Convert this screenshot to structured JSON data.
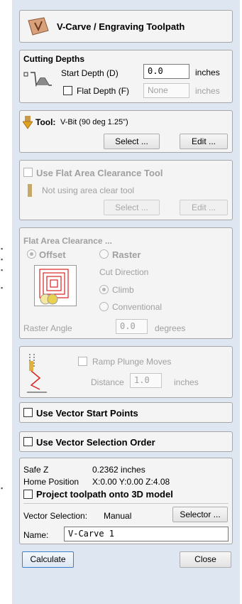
{
  "title": "V-Carve / Engraving Toolpath",
  "cutting_depths": {
    "heading": "Cutting Depths",
    "start_depth_label": "Start Depth (D)",
    "start_depth_value": "0.0",
    "start_depth_unit": "inches",
    "flat_depth_label": "Flat Depth (F)",
    "flat_depth_placeholder": "None",
    "flat_depth_unit": "inches"
  },
  "tool": {
    "label": "Tool:",
    "name": "V-Bit (90 deg 1.25\")",
    "select_label": "Select ...",
    "edit_label": "Edit ..."
  },
  "area_clear": {
    "checkbox_label": "Use Flat Area Clearance Tool",
    "status": "Not using area clear tool",
    "select_label": "Select ...",
    "edit_label": "Edit ..."
  },
  "flat_area": {
    "heading": "Flat Area Clearance ...",
    "offset_label": "Offset",
    "raster_label": "Raster",
    "cut_direction_label": "Cut Direction",
    "climb_label": "Climb",
    "conventional_label": "Conventional",
    "raster_angle_label": "Raster Angle",
    "raster_angle_value": "0.0",
    "raster_angle_unit": "degrees"
  },
  "ramp": {
    "checkbox_label": "Ramp Plunge Moves",
    "distance_label": "Distance",
    "distance_value": "1.0",
    "distance_unit": "inches"
  },
  "vector_start_points_label": "Use Vector Start Points",
  "vector_selection_order_label": "Use Vector Selection Order",
  "settings": {
    "safe_z_label": "Safe Z",
    "safe_z_value": "0.2362 inches",
    "home_label": "Home Position",
    "home_value": "X:0.00 Y:0.00 Z:4.08",
    "project_label": "Project toolpath onto 3D model",
    "vector_selection_label": "Vector Selection:",
    "vector_selection_value": "Manual",
    "selector_label": "Selector ...",
    "name_label": "Name:",
    "name_value": "V-Carve 1"
  },
  "footer": {
    "calculate_label": "Calculate",
    "close_label": "Close"
  }
}
